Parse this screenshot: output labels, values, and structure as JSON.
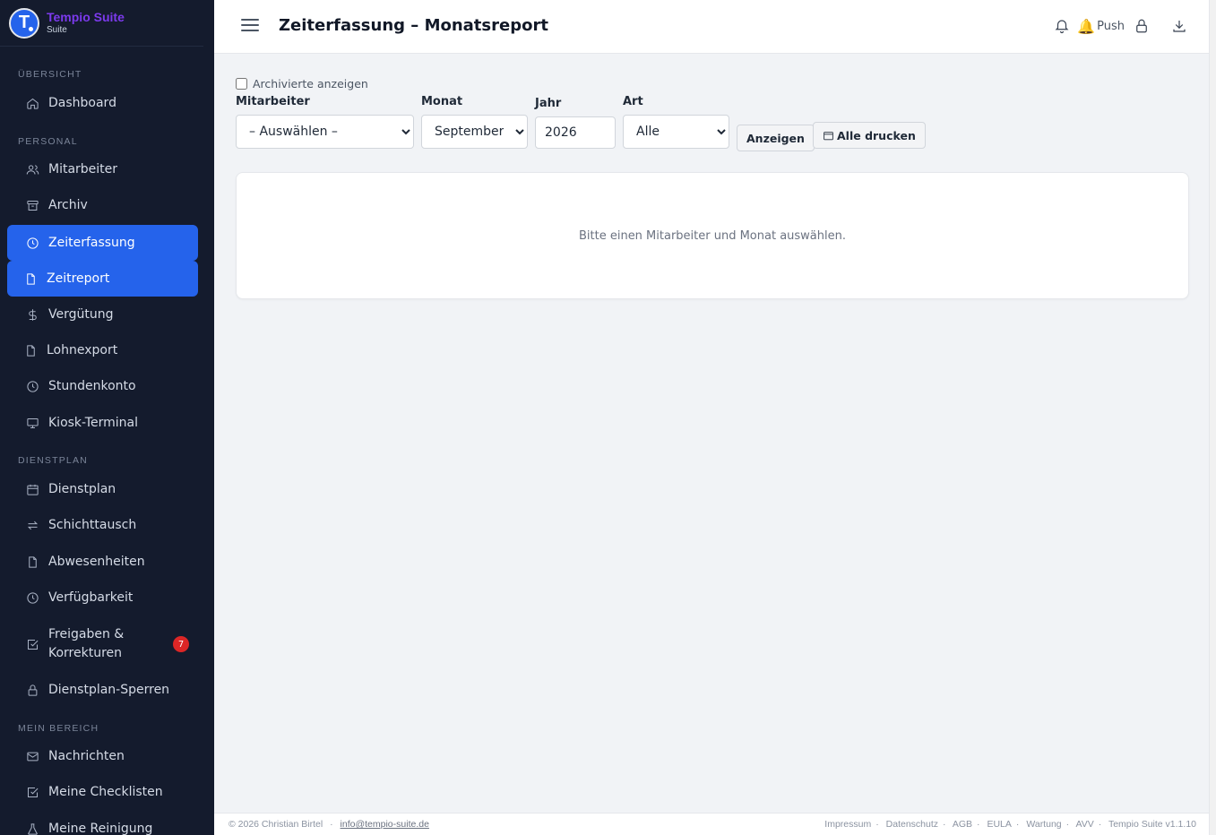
{
  "brand": {
    "name": "Tempio Suite",
    "sub": "Suite",
    "logo_letter": "T"
  },
  "sidebar": {
    "sections": {
      "overview": "ÜBERSICHT",
      "personal": "PERSONAL",
      "dienstplan": "DIENSTPLAN",
      "mein_bereich": "MEIN BEREICH"
    },
    "items": [
      {
        "label": "Dashboard",
        "icon": "home-icon"
      },
      {
        "label": "Mitarbeiter",
        "icon": "users-icon"
      },
      {
        "label": "Archiv",
        "icon": "archive-icon"
      },
      {
        "label": "Zeiterfassung",
        "icon": "clock-icon",
        "active": true
      },
      {
        "label": "Zeitreport",
        "icon": "file-icon",
        "active": true
      },
      {
        "label": "Vergütung",
        "icon": "dollar-icon"
      },
      {
        "label": "Lohnexport",
        "icon": "file-icon"
      },
      {
        "label": "Stundenkonto",
        "icon": "clock-icon"
      },
      {
        "label": "Kiosk-Terminal",
        "icon": "monitor-icon"
      },
      {
        "label": "Dienstplan",
        "icon": "calendar-icon"
      },
      {
        "label": "Schichttausch",
        "icon": "swap-icon"
      },
      {
        "label": "Abwesenheiten",
        "icon": "file-icon"
      },
      {
        "label": "Verfügbarkeit",
        "icon": "clock-icon"
      },
      {
        "label": "Freigaben & Korrekturen",
        "icon": "check-square-icon",
        "badge": "7"
      },
      {
        "label": "Dienstplan-Sperren",
        "icon": "lock-icon"
      },
      {
        "label": "Nachrichten",
        "icon": "mail-icon"
      },
      {
        "label": "Meine Checklisten",
        "icon": "check-square-icon"
      },
      {
        "label": "Meine Reinigung",
        "icon": "flask-icon"
      }
    ]
  },
  "header": {
    "title": "Zeiterfassung – Monatsreport",
    "push_label": "Push"
  },
  "filters": {
    "archived_label": "Archivierte anzeigen",
    "archived_checked": false,
    "employee_label": "Mitarbeiter",
    "employee_value": "– Auswählen –",
    "month_label": "Monat",
    "month_value": "September",
    "year_label": "Jahr",
    "year_value": "2026",
    "type_label": "Art",
    "type_value": "Alle",
    "show_button": "Anzeigen",
    "print_button": "Alle drucken"
  },
  "empty_message": "Bitte einen Mitarbeiter und Monat auswählen.",
  "footer": {
    "copyright": "© 2026 Christian Birtel",
    "email": "info@tempio-suite.de",
    "links": [
      "Impressum",
      "Datenschutz",
      "AGB",
      "EULA",
      "Wartung",
      "AVV",
      "Tempio Suite v1.1.10"
    ]
  },
  "colors": {
    "accent": "#2563eb",
    "sidebar_bg": "#141b2d",
    "brand": "#7c3aed",
    "badge": "#dc2626"
  }
}
